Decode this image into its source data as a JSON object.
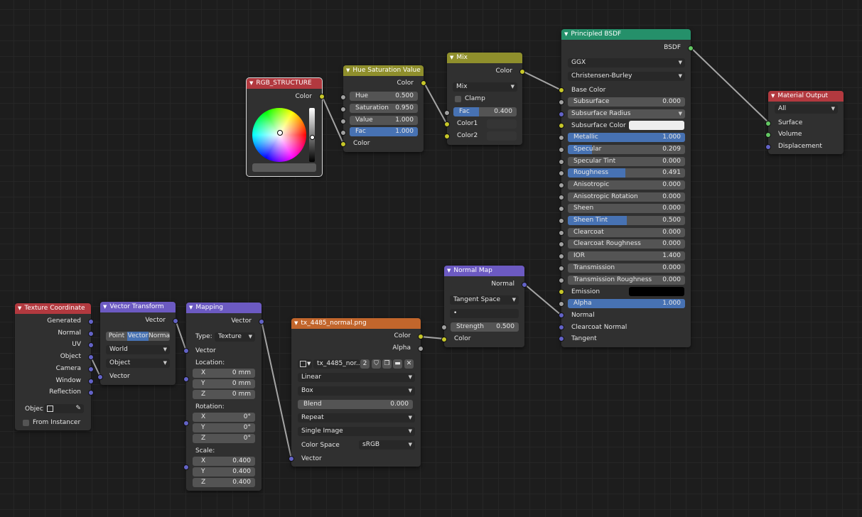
{
  "colors": {
    "grid_bg": "#1d1d1d",
    "node_bg": "#303030",
    "link": "#a5a5a5",
    "accent_fill": "#4772b3",
    "header_input": "#b2393f",
    "header_converter": "#6c5ac2",
    "header_color": "#8f8f2c",
    "header_texture": "#c2662c",
    "header_shader": "#25906a",
    "header_output": "#b2393f"
  },
  "nodes": {
    "rgb": {
      "title": "RGB_STRUCTURE",
      "out_color": "Color"
    },
    "hsv": {
      "title": "Hue Saturation Value",
      "out_color": "Color",
      "hue_label": "Hue",
      "hue_value": "0.500",
      "sat_label": "Saturation",
      "sat_value": "0.950",
      "val_label": "Value",
      "val_value": "1.000",
      "fac_label": "Fac",
      "fac_value": "1.000",
      "in_color": "Color"
    },
    "mix": {
      "title": "Mix",
      "out_color": "Color",
      "blend_mode": "Mix",
      "clamp_label": "Clamp",
      "fac_label": "Fac",
      "fac_value": "0.400",
      "fac_fraction": 0.4,
      "color1": "Color1",
      "color2": "Color2"
    },
    "bsdf": {
      "title": "Principled BSDF",
      "out_bsdf": "BSDF",
      "distribution": "GGX",
      "subsurface_method": "Christensen-Burley",
      "base_color": "Base Color",
      "rows": [
        {
          "label": "Subsurface",
          "value": "0.000",
          "fill": 0
        },
        {
          "label": "Subsurface Radius",
          "dropdown": true
        },
        {
          "label": "Subsurface Color",
          "swatch": "#eeeeee"
        },
        {
          "label": "Metallic",
          "value": "1.000",
          "fill": 1
        },
        {
          "label": "Specular",
          "value": "0.209",
          "fill": 0.209
        },
        {
          "label": "Specular Tint",
          "value": "0.000",
          "fill": 0
        },
        {
          "label": "Roughness",
          "value": "0.491",
          "fill": 0.491
        },
        {
          "label": "Anisotropic",
          "value": "0.000",
          "fill": 0
        },
        {
          "label": "Anisotropic Rotation",
          "value": "0.000",
          "fill": 0
        },
        {
          "label": "Sheen",
          "value": "0.000",
          "fill": 0
        },
        {
          "label": "Sheen Tint",
          "value": "0.500",
          "fill": 0.5
        },
        {
          "label": "Clearcoat",
          "value": "0.000",
          "fill": 0
        },
        {
          "label": "Clearcoat Roughness",
          "value": "0.000",
          "fill": 0
        },
        {
          "label": "IOR",
          "value": "1.400",
          "fill": 0
        },
        {
          "label": "Transmission",
          "value": "0.000",
          "fill": 0
        },
        {
          "label": "Transmission Roughness",
          "value": "0.000",
          "fill": 0
        },
        {
          "label": "Emission",
          "swatch": "#000000"
        },
        {
          "label": "Alpha",
          "value": "1.000",
          "fill": 1
        }
      ],
      "normal": "Normal",
      "clearcoat_normal": "Clearcoat Normal",
      "tangent": "Tangent"
    },
    "output": {
      "title": "Material Output",
      "target": "All",
      "surface": "Surface",
      "volume": "Volume",
      "displacement": "Displacement"
    },
    "texcoord": {
      "title": "Texture Coordinate",
      "outputs": [
        "Generated",
        "Normal",
        "UV",
        "Object",
        "Camera",
        "Window",
        "Reflection"
      ],
      "object_label": "Objec",
      "from_instancer": "From Instancer"
    },
    "vtrans": {
      "title": "Vector Transform",
      "out_vector": "Vector",
      "types": [
        "Point",
        "Vector",
        "Norma"
      ],
      "from_space": "World",
      "to_space": "Object",
      "in_vector": "Vector"
    },
    "mapping": {
      "title": "Mapping",
      "out_vector": "Vector",
      "type_label": "Type:",
      "type_value": "Texture",
      "in_vector": "Vector",
      "location_label": "Location:",
      "loc": [
        {
          "axis": "X",
          "value": "0 mm"
        },
        {
          "axis": "Y",
          "value": "0 mm"
        },
        {
          "axis": "Z",
          "value": "0 mm"
        }
      ],
      "rotation_label": "Rotation:",
      "rot": [
        {
          "axis": "X",
          "value": "0°"
        },
        {
          "axis": "Y",
          "value": "0°"
        },
        {
          "axis": "Z",
          "value": "0°"
        }
      ],
      "scale_label": "Scale:",
      "scale": [
        {
          "axis": "X",
          "value": "0.400"
        },
        {
          "axis": "Y",
          "value": "0.400"
        },
        {
          "axis": "Z",
          "value": "0.400"
        }
      ]
    },
    "image": {
      "title": "tx_4485_normal.png",
      "out_color": "Color",
      "out_alpha": "Alpha",
      "image_name": "tx_4485_nor...",
      "users": "2",
      "interpolation": "Linear",
      "projection": "Box",
      "blend_label": "Blend",
      "blend_value": "0.000",
      "extension": "Repeat",
      "source": "Single Image",
      "color_space_label": "Color Space",
      "color_space": "sRGB",
      "in_vector": "Vector"
    },
    "normalmap": {
      "title": "Normal Map",
      "out_normal": "Normal",
      "space": "Tangent Space",
      "uv_value": "•",
      "strength_label": "Strength",
      "strength_value": "0.500",
      "in_color": "Color"
    }
  }
}
